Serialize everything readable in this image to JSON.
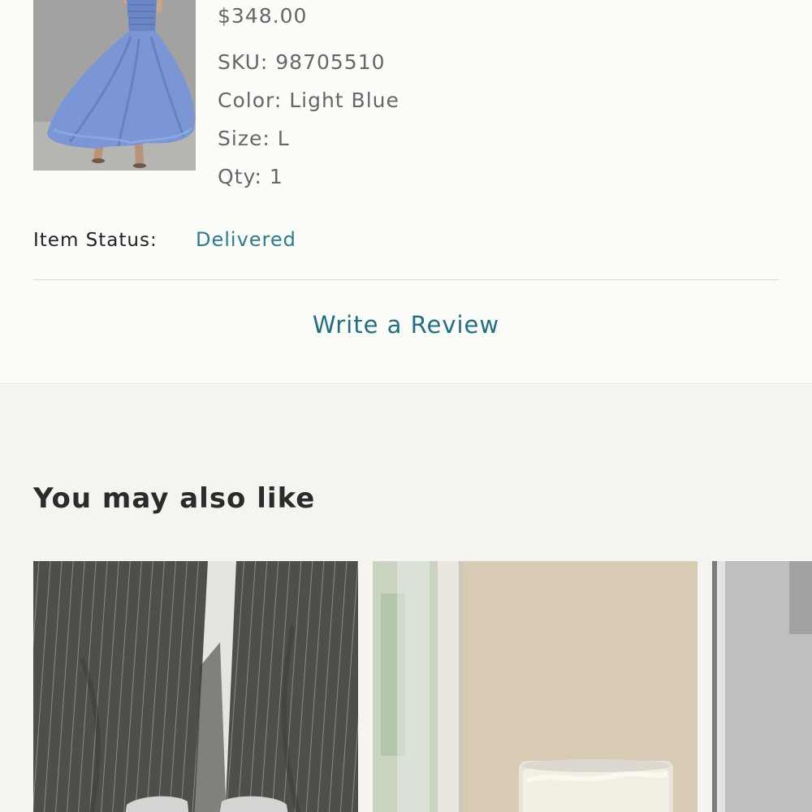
{
  "order_item": {
    "image_alt": "Light blue strapless ball gown",
    "price": "$348.00",
    "sku": "SKU: 98705510",
    "color": "Color: Light Blue",
    "size": "Size: L",
    "qty": "Qty: 1",
    "status_label": "Item Status:",
    "status_value": "Delivered",
    "review_link": "Write a Review"
  },
  "recommendations": {
    "title": "You may also like",
    "items": [
      {
        "image_alt": "Grey pinstripe trousers with sneakers"
      },
      {
        "image_alt": "Glass candle on a windowsill"
      },
      {
        "image_alt": "Product photo"
      }
    ]
  },
  "colors": {
    "background": "#fcfcf8",
    "recs_background": "#f5f4f1",
    "accent": "#2a7c90",
    "text_dark": "#2e2e2e",
    "text_muted": "#676767"
  }
}
